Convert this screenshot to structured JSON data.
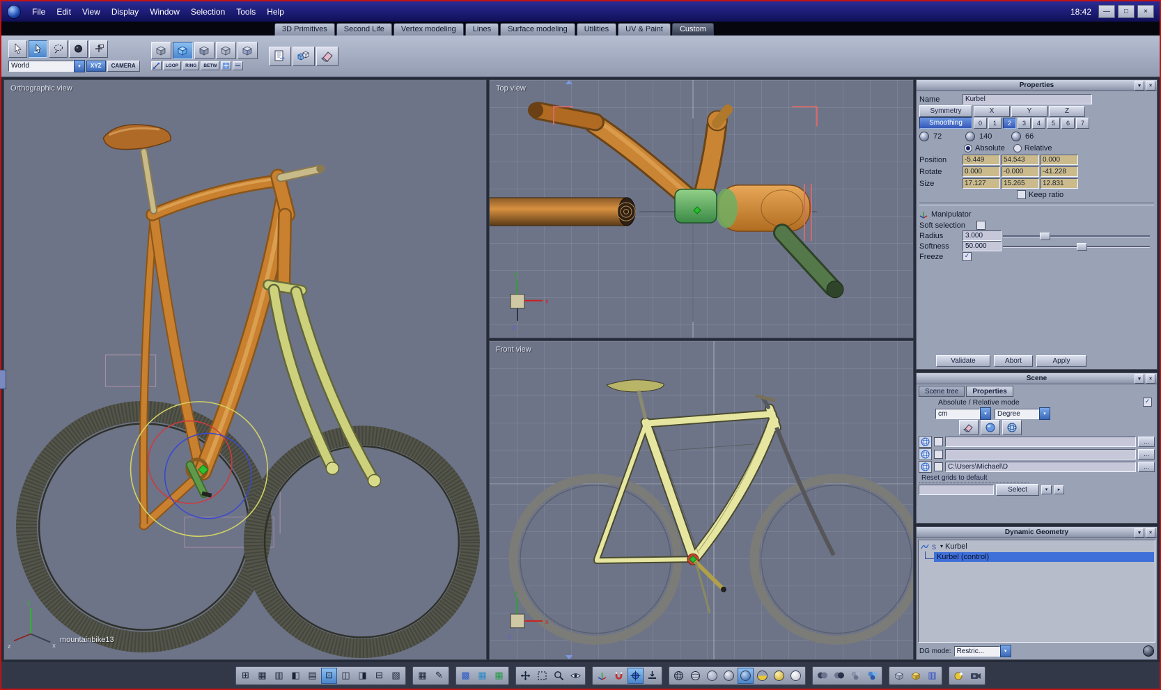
{
  "window": {
    "clock": "18:42"
  },
  "menu": {
    "items": [
      "File",
      "Edit",
      "View",
      "Display",
      "Window",
      "Selection",
      "Tools",
      "Help"
    ]
  },
  "tabs": {
    "items": [
      {
        "label": "3D Primitives"
      },
      {
        "label": "Second Life"
      },
      {
        "label": "Vertex modeling"
      },
      {
        "label": "Lines"
      },
      {
        "label": "Surface modeling"
      },
      {
        "label": "Utilities"
      },
      {
        "label": "UV & Paint"
      },
      {
        "label": "Custom"
      }
    ],
    "active": "Custom"
  },
  "toolbar": {
    "world": "World",
    "xyz": "XYZ",
    "camera": "CAMERA",
    "loop": "LOOP",
    "ring": "RING",
    "betw": "BETW"
  },
  "viewports": {
    "orthographic": {
      "label": "Orthographic view",
      "model": "mountainbike13"
    },
    "top": {
      "label": "Top view"
    },
    "front": {
      "label": "Front view"
    }
  },
  "properties": {
    "title": "Properties",
    "name_label": "Name",
    "name_value": "Kurbel",
    "symmetry": "Symmetry",
    "axes": [
      "X",
      "Y",
      "Z"
    ],
    "smoothing": "Smoothing",
    "levels": [
      "0",
      "1",
      "2",
      "3",
      "4",
      "5",
      "6",
      "7"
    ],
    "active_level": "2",
    "counts": {
      "c1": "72",
      "c2": "140",
      "c3": "66"
    },
    "absolute": "Absolute",
    "relative": "Relative",
    "position_label": "Position",
    "position": [
      "-5.449",
      "54.543",
      "0.000"
    ],
    "rotate_label": "Rotate",
    "rotate": [
      "0.000",
      "-0.000",
      "-41.228"
    ],
    "size_label": "Size",
    "size": [
      "17.127",
      "15.265",
      "12.831"
    ],
    "keep_ratio": "Keep ratio",
    "manipulator": "Manipulator",
    "soft_selection": "Soft selection",
    "radius_label": "Radius",
    "radius_value": "3.000",
    "softness_label": "Softness",
    "softness_value": "50.000",
    "freeze": "Freeze",
    "validate": "Validate",
    "abort": "Abort",
    "apply": "Apply"
  },
  "scene": {
    "title": "Scene",
    "tab_tree": "Scene tree",
    "tab_props": "Properties",
    "mode_label": "Absolute / Relative mode",
    "unit": "cm",
    "angle": "Degree",
    "grid_rows": [
      {
        "path": ""
      },
      {
        "path": ""
      },
      {
        "path": "C:\\Users\\Michael\\D"
      }
    ],
    "ellipsis": "...",
    "reset": "Reset grids to default",
    "select": "Select"
  },
  "dynamic_geometry": {
    "title": "Dynamic Geometry",
    "root": "Kurbel",
    "child": "Kurbel (control)",
    "dg_mode": "DG mode:",
    "dg_value": "Restric..."
  },
  "colors": {
    "accent_blue": "#3f6fd8",
    "selection_blue": "#4a84cc",
    "field_tan": "#cbbb8c",
    "viewport_bg": "#6d7488",
    "titlebar_navy": "#16166b",
    "window_border_red": "#c41212",
    "frame_orange": "#c9802f",
    "fork_yellow": "#cdd17c"
  }
}
